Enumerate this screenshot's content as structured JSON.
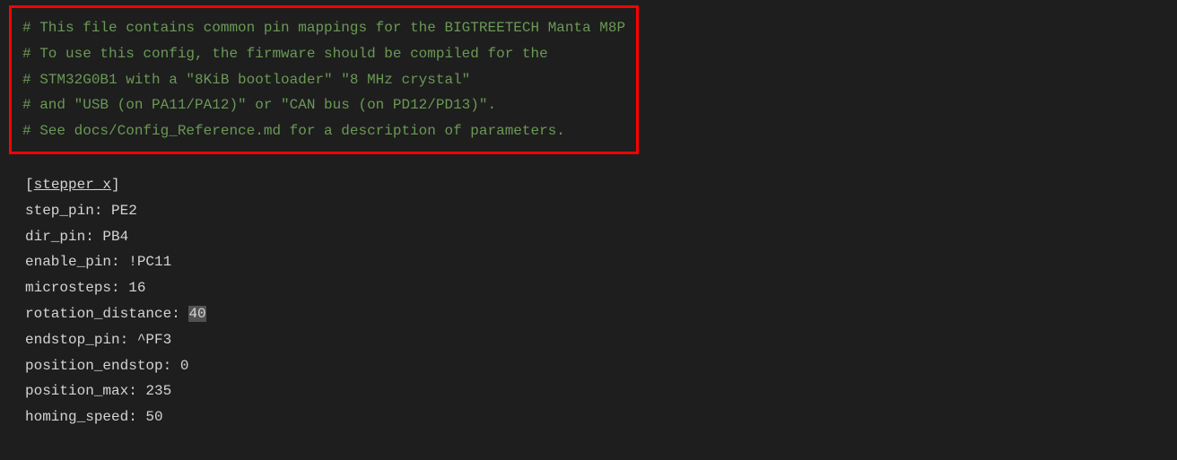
{
  "comments": {
    "line1": "# This file contains common pin mappings for the BIGTREETECH Manta M8P",
    "line2": "# To use this config, the firmware should be compiled for the",
    "line3": "# STM32G0B1 with a \"8KiB bootloader\" \"8 MHz crystal\"",
    "line4": "# and \"USB (on PA11/PA12)\" or \"CAN bus (on PD12/PD13)\".",
    "line5": "",
    "line6": "# See docs/Config_Reference.md for a description of parameters."
  },
  "section": {
    "bracket_open": "[",
    "name": "stepper_x",
    "bracket_close": "]"
  },
  "config": {
    "step_pin": {
      "key": "step_pin: ",
      "value": "PE2"
    },
    "dir_pin": {
      "key": "dir_pin: ",
      "value": "PB4"
    },
    "enable_pin": {
      "key": "enable_pin: ",
      "value": "!PC11"
    },
    "microsteps": {
      "key": "microsteps: ",
      "value": "16"
    },
    "rotation_distance": {
      "key": "rotation_distance: ",
      "value": "40"
    },
    "endstop_pin": {
      "key": "endstop_pin: ",
      "value": "^PF3"
    },
    "position_endstop": {
      "key": "position_endstop: ",
      "value": "0"
    },
    "position_max": {
      "key": "position_max: ",
      "value": "235"
    },
    "homing_speed": {
      "key": "homing_speed: ",
      "value": "50"
    }
  }
}
